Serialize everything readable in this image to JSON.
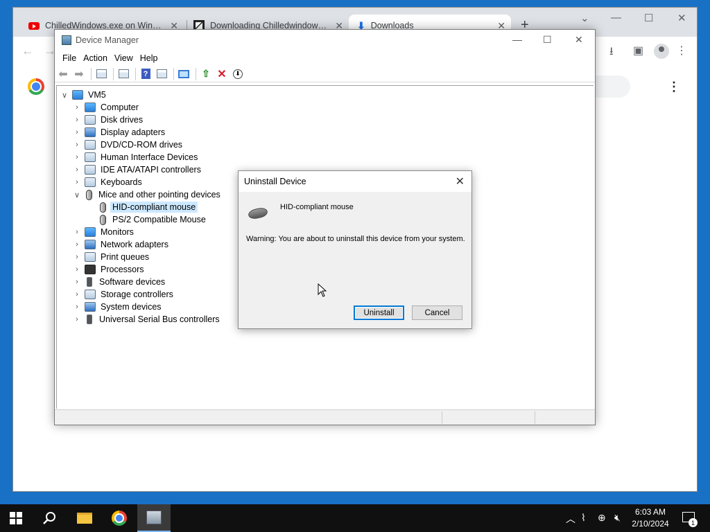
{
  "browser": {
    "tabs": [
      {
        "title": "ChilledWindows.exe on Window",
        "icon": "youtube-icon"
      },
      {
        "title": "Downloading Chilledwindows.ex",
        "icon": "file-icon"
      },
      {
        "title": "Downloads",
        "icon": "download-icon"
      }
    ],
    "new_tab": "+",
    "minimize": "—",
    "maximize": "☐",
    "close": "✕"
  },
  "device_manager": {
    "title": "Device Manager",
    "menu": [
      "File",
      "Action",
      "View",
      "Help"
    ],
    "root": "VM5",
    "categories": [
      {
        "label": "Computer",
        "expanded": false
      },
      {
        "label": "Disk drives",
        "expanded": false
      },
      {
        "label": "Display adapters",
        "expanded": false
      },
      {
        "label": "DVD/CD-ROM drives",
        "expanded": false
      },
      {
        "label": "Human Interface Devices",
        "expanded": false
      },
      {
        "label": "IDE ATA/ATAPI controllers",
        "expanded": false
      },
      {
        "label": "Keyboards",
        "expanded": false
      },
      {
        "label": "Mice and other pointing devices",
        "expanded": true,
        "children": [
          {
            "label": "HID-compliant mouse",
            "selected": true
          },
          {
            "label": "PS/2 Compatible Mouse",
            "selected": false
          }
        ]
      },
      {
        "label": "Monitors",
        "expanded": false
      },
      {
        "label": "Network adapters",
        "expanded": false
      },
      {
        "label": "Print queues",
        "expanded": false
      },
      {
        "label": "Processors",
        "expanded": false
      },
      {
        "label": "Software devices",
        "expanded": false
      },
      {
        "label": "Storage controllers",
        "expanded": false
      },
      {
        "label": "System devices",
        "expanded": false
      },
      {
        "label": "Universal Serial Bus controllers",
        "expanded": false
      }
    ]
  },
  "dialog": {
    "title": "Uninstall Device",
    "device_name": "HID-compliant mouse",
    "warning": "Warning: You are about to uninstall this device from your system.",
    "uninstall_label": "Uninstall",
    "cancel_label": "Cancel"
  },
  "taskbar": {
    "time": "6:03 AM",
    "date": "2/10/2024",
    "notification_count": "1"
  }
}
